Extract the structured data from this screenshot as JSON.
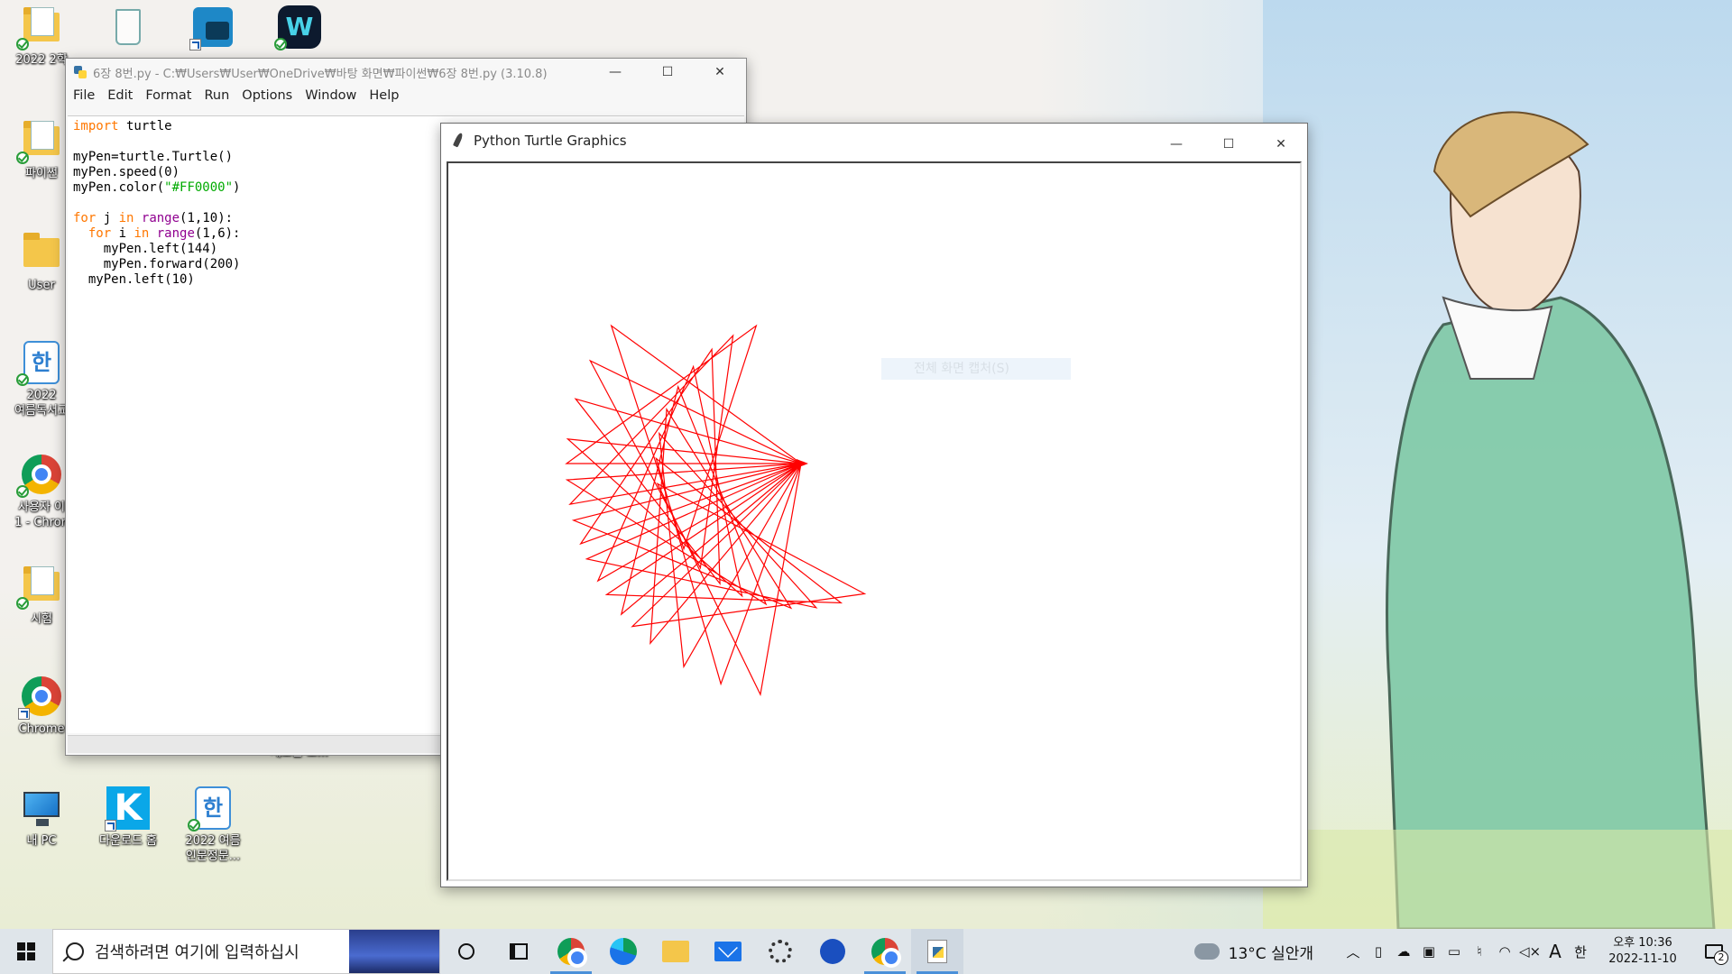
{
  "desktop": {
    "icons": [
      {
        "label": "2022 2학"
      },
      {
        "label": ""
      },
      {
        "label": ""
      },
      {
        "label": ""
      },
      {
        "label": "파이썬"
      },
      {
        "label": "User"
      },
      {
        "label": "2022"
      },
      {
        "label": "여름독서교"
      },
      {
        "label": "사용자 이"
      },
      {
        "label": "1 - Chron"
      },
      {
        "label": "시험"
      },
      {
        "label": "Chrome"
      },
      {
        "label": "내 PC"
      },
      {
        "label": "다운로드 홈"
      },
      {
        "label": "2022 여름"
      },
      {
        "label": "인문정문..."
      },
      {
        "label": "새로운 도..."
      }
    ]
  },
  "idle": {
    "title": "6장 8번.py - C:₩Users₩User₩OneDrive₩바탕 화면₩파이썬₩6장 8번.py (3.10.8)",
    "menu": [
      "File",
      "Edit",
      "Format",
      "Run",
      "Options",
      "Window",
      "Help"
    ],
    "code": {
      "l1_kw": "import",
      "l1_rest": " turtle",
      "l3": "myPen=turtle.Turtle()",
      "l4": "myPen.speed(0)",
      "l5_a": "myPen.color(",
      "l5_str": "\"#FF0000\"",
      "l5_b": ")",
      "l7_kw": "for",
      "l7_a": " j ",
      "l7_in": "in",
      "l7_sp": " ",
      "l7_bi": "range",
      "l7_b": "(1,10):",
      "l8_pre": "  ",
      "l8_kw": "for",
      "l8_a": " i ",
      "l8_in": "in",
      "l8_sp": " ",
      "l8_bi": "range",
      "l8_b": "(1,6):",
      "l9": "    myPen.left(144)",
      "l10": "    myPen.forward(200)",
      "l11": "  myPen.left(10)"
    }
  },
  "turtle": {
    "title": "Python Turtle Graphics",
    "ghost_text": "전체 화면 캡처(S)",
    "pen_color": "#FF0000",
    "program": {
      "outer": 9,
      "inner": 5,
      "inner_turn": 144,
      "forward": 200,
      "outer_turn": 10
    }
  },
  "window_caps": {
    "minimize": "—",
    "maximize": "☐",
    "close": "✕"
  },
  "taskbar": {
    "search_placeholder": "검색하려면 여기에 입력하십시",
    "weather": "13°C  실안개",
    "ime": "A",
    "lang": "한",
    "time_ampm": "오후 10:36",
    "date": "2022-11-10",
    "notifications": "2",
    "tray_icons": [
      "chevron-up-icon",
      "device-icon",
      "cloud-icon",
      "battery-icon",
      "mic-icon",
      "wifi-icon",
      "volume-muted-icon"
    ]
  }
}
